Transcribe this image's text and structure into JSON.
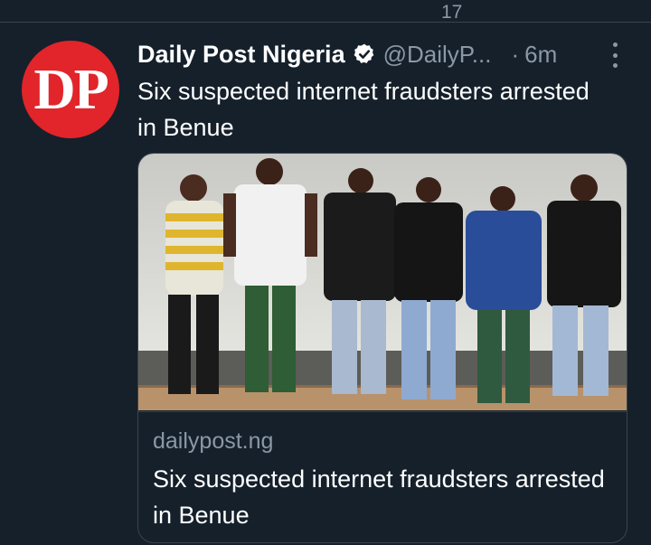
{
  "previous_tweet": {
    "count": "17"
  },
  "tweet": {
    "avatar_initials": "DP",
    "author_name": "Daily Post Nigeria",
    "handle": "@DailyP...",
    "separator": "·",
    "time": "6m",
    "text": "Six suspected internet fraudsters arrested in Benue",
    "card": {
      "domain": "dailypost.ng",
      "title": "Six suspected internet fraudsters arrested in Benue",
      "image_description": "Six men standing facing a wall"
    }
  },
  "colors": {
    "background": "#15202b",
    "border": "#38444d",
    "secondary_text": "#8b98a5",
    "avatar_red": "#e1252a",
    "verified_badge": "#ffffff"
  },
  "icons": {
    "verified": "verified-badge-icon",
    "more": "more-options-icon"
  }
}
